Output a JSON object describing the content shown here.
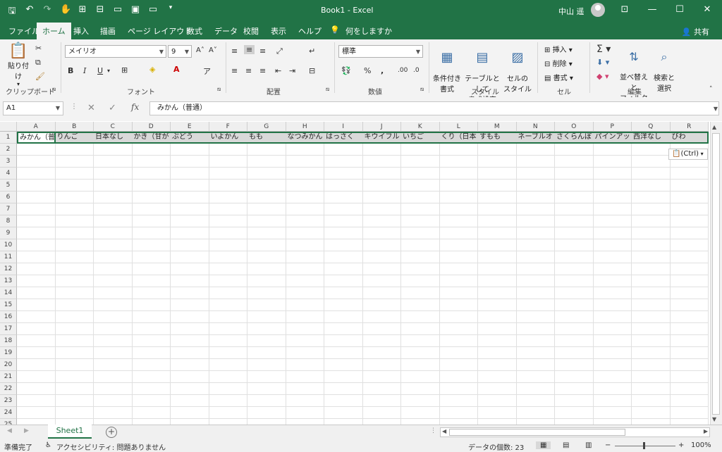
{
  "window": {
    "title": "Book1  -  Excel",
    "user": "中山 遥",
    "share_label": "共有"
  },
  "menu": {
    "tabs": [
      "ファイル",
      "ホーム",
      "挿入",
      "描画",
      "ページ レイアウト",
      "数式",
      "データ",
      "校閲",
      "表示",
      "ヘルプ"
    ],
    "tell_me": "何をしますか"
  },
  "ribbon": {
    "clipboard": {
      "paste_label": "貼り付け",
      "group": "クリップボード"
    },
    "font": {
      "name": "メイリオ",
      "size": "9",
      "group": "フォント"
    },
    "alignment": {
      "group": "配置"
    },
    "number": {
      "format": "標準",
      "group": "数値"
    },
    "styles": {
      "conditional": "条件付き\n書式",
      "table": "テーブルとして\n書式設定",
      "cell_style": "セルの\nスタイル",
      "group": "スタイル"
    },
    "cells": {
      "insert": "挿入",
      "delete": "削除",
      "format": "書式",
      "group": "セル"
    },
    "editing": {
      "sort": "並べ替えと\nフィルター",
      "find": "検索と\n選択",
      "group": "編集"
    }
  },
  "formula_bar": {
    "name_box": "A1",
    "content": "みかん（普通）"
  },
  "sheet": {
    "columns": [
      "A",
      "B",
      "C",
      "D",
      "E",
      "F",
      "G",
      "H",
      "I",
      "J",
      "K",
      "L",
      "M",
      "N",
      "O",
      "P",
      "Q",
      "R"
    ],
    "row_count": 25,
    "row1_values": [
      "みかん（普",
      "りんご",
      "日本なし",
      "かき（甘が",
      "ぶどう",
      "いよかん",
      "もも",
      "なつみかん",
      "はっさく",
      "キウイフル",
      "いちご",
      "くり（日本",
      "すもも",
      "ネーブルオ",
      "さくらんぼ",
      "パインアッ",
      "西洋なし",
      "びわ"
    ],
    "paste_options": "(Ctrl)",
    "tab_name": "Sheet1"
  },
  "status": {
    "ready": "準備完了",
    "accessibility": "アクセシビリティ: 問題ありません",
    "count": "データの個数: 23",
    "zoom": "100%"
  }
}
